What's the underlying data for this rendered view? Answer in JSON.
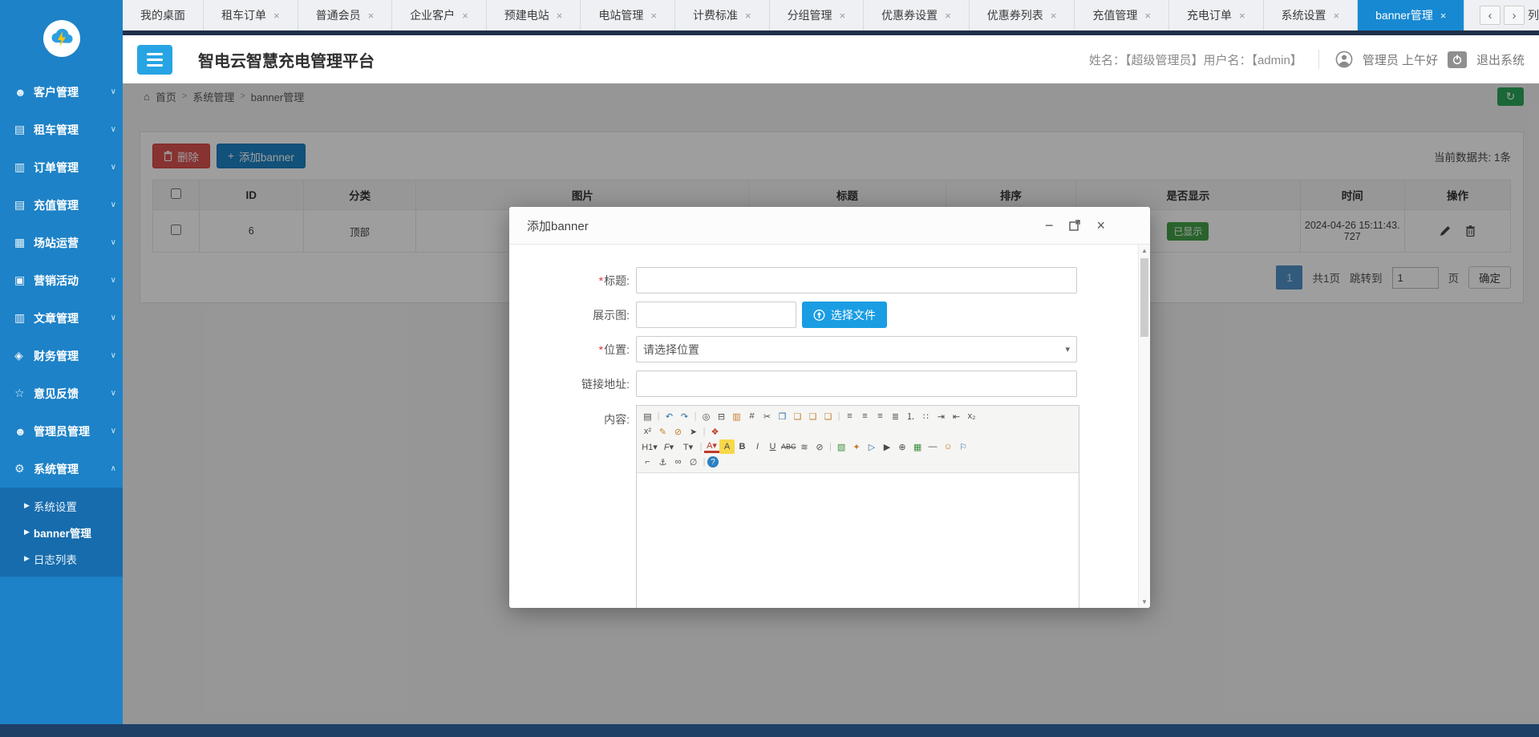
{
  "colors": {
    "sidebar_blue": "#1d82c7",
    "submenu_blue": "#176cad",
    "active_tab_blue": "#1789d2",
    "bright_blue": "#1a9de2",
    "add_blue": "#1c84c6",
    "danger_red": "#d9534f",
    "success_green": "#43a047",
    "refresh_green": "#2aa65a",
    "pager_blue": "#5192ca",
    "tab_border_dark": "#20304a",
    "footer_navy": "#1e4066"
  },
  "tabbar": {
    "close_glyph": "×",
    "prev": "‹",
    "next": "›",
    "overflow_label": "列",
    "tabs": [
      {
        "label": "我的桌面",
        "name": "tab-my-desktop",
        "noclose": true
      },
      {
        "label": "租车订单",
        "name": "tab-car-rental-orders"
      },
      {
        "label": "普通会员",
        "name": "tab-regular-members"
      },
      {
        "label": "企业客户",
        "name": "tab-enterprise-customers"
      },
      {
        "label": "预建电站",
        "name": "tab-prebuilt-stations"
      },
      {
        "label": "电站管理",
        "name": "tab-station-management"
      },
      {
        "label": "计费标准",
        "name": "tab-billing-standards"
      },
      {
        "label": "分组管理",
        "name": "tab-group-management"
      },
      {
        "label": "优惠券设置",
        "name": "tab-coupon-settings"
      },
      {
        "label": "优惠券列表",
        "name": "tab-coupon-list"
      },
      {
        "label": "充值管理",
        "name": "tab-recharge-management"
      },
      {
        "label": "充电订单",
        "name": "tab-charging-orders"
      },
      {
        "label": "系统设置",
        "name": "tab-system-settings"
      },
      {
        "label": "banner管理",
        "name": "tab-banner-management",
        "cls": "active"
      }
    ]
  },
  "sidebar": {
    "submenu_arrow": "▶",
    "menu": [
      {
        "icon": "☻",
        "iconname": "customer-icon",
        "label": "客户管理",
        "chev": "∨",
        "name": "sidebar-item-customer-mgmt"
      },
      {
        "icon": "▤",
        "iconname": "rental-card-icon",
        "label": "租车管理",
        "chev": "∨",
        "name": "sidebar-item-rental-mgmt"
      },
      {
        "icon": "▥",
        "iconname": "order-file-icon",
        "label": "订单管理",
        "chev": "∨",
        "name": "sidebar-item-order-mgmt"
      },
      {
        "icon": "▤",
        "iconname": "recharge-card-icon",
        "label": "充值管理",
        "chev": "∨",
        "name": "sidebar-item-recharge-mgmt"
      },
      {
        "icon": "▦",
        "iconname": "station-building-icon",
        "label": "场站运营",
        "chev": "∨",
        "name": "sidebar-item-station-ops"
      },
      {
        "icon": "▣",
        "iconname": "marketing-book-icon",
        "label": "营销活动",
        "chev": "∨",
        "name": "sidebar-item-marketing"
      },
      {
        "icon": "▥",
        "iconname": "article-doc-icon",
        "label": "文章管理",
        "chev": "∨",
        "name": "sidebar-item-article-mgmt"
      },
      {
        "icon": "◈",
        "iconname": "finance-lock-icon",
        "label": "财务管理",
        "chev": "∨",
        "name": "sidebar-item-finance-mgmt"
      },
      {
        "icon": "☆",
        "iconname": "feedback-star-icon",
        "label": "意见反馈",
        "chev": "∨",
        "name": "sidebar-item-feedback"
      },
      {
        "icon": "☻",
        "iconname": "admin-user-icon",
        "label": "管理员管理",
        "chev": "∨",
        "name": "sidebar-item-admin-mgmt"
      },
      {
        "icon": "⚙",
        "iconname": "system-gear-icon",
        "label": "系统管理",
        "chev": "∧",
        "name": "sidebar-item-system-mgmt"
      }
    ],
    "submenu": [
      {
        "label": "系统设置",
        "name": "submenu-system-settings"
      },
      {
        "label": "banner管理",
        "name": "submenu-banner-mgmt",
        "cls": "active"
      },
      {
        "label": "日志列表",
        "name": "submenu-log-list"
      }
    ]
  },
  "header": {
    "title": "智电云智慧充电管理平台",
    "user_info": "姓名：【超级管理员】用户名：【admin】",
    "greeting": "管理员 上午好",
    "logout": "退出系统"
  },
  "breadcrumb": {
    "home_icon": "⌂",
    "home": "首页",
    "sep": ">",
    "level1": "系统管理",
    "level2": "banner管理"
  },
  "panel": {
    "delete_btn": "删除",
    "add_icon": "+",
    "add_btn": "添加banner",
    "total": "当前数据共: 1条"
  },
  "table": {
    "headers": [
      "ID",
      "分类",
      "图片",
      "标题",
      "排序",
      "是否显示",
      "时间",
      "操作"
    ],
    "row": {
      "id": "6",
      "category": "顶部",
      "image": "",
      "title": "",
      "sort": "",
      "status": "已显示",
      "time": "2024-04-26 15:11:43.727"
    }
  },
  "pagination": {
    "page": "1",
    "total": "共1页",
    "jump_label": "跳转到",
    "jump_value": "1",
    "unit": "页",
    "confirm": "确定"
  },
  "modal": {
    "title": "添加banner",
    "min_glyph": "−",
    "close_glyph": "×",
    "scroll_up": "▲",
    "scroll_down": "▼",
    "fields": {
      "required_mark": "*",
      "title_label": "标题:",
      "image_label": "展示图:",
      "choose_file": "选择文件",
      "position_label": "位置:",
      "position_value": "请选择位置",
      "select_arrow": "▾",
      "link_label": "链接地址:",
      "content_label": "内容:"
    }
  },
  "editor": {
    "row1": [
      {
        "g": "▤",
        "n": "source-icon"
      },
      {
        "g": "|",
        "n": "separator-bar",
        "cls": "sep",
        "int": "false"
      },
      {
        "g": "↶",
        "n": "undo-icon",
        "cls": "blue"
      },
      {
        "g": "↷",
        "n": "redo-icon",
        "cls": "blue"
      },
      {
        "g": "|",
        "n": "separator-bar",
        "cls": "sep",
        "int": "false"
      },
      {
        "g": "◎",
        "n": "preview-icon"
      },
      {
        "g": "⊟",
        "n": "print-icon"
      },
      {
        "g": "▥",
        "n": "template-icon",
        "cls": "orange"
      },
      {
        "g": "#",
        "n": "code-icon"
      },
      {
        "g": "✂",
        "n": "cut-icon"
      },
      {
        "g": "❐",
        "n": "copy-icon",
        "cls": "blue"
      },
      {
        "g": "❏",
        "n": "paste-icon",
        "cls": "orange"
      },
      {
        "g": "❏",
        "n": "paste-text-icon",
        "cls": "orange"
      },
      {
        "g": "❏",
        "n": "paste-word-icon",
        "cls": "orange"
      },
      {
        "g": "|",
        "n": "separator-bar",
        "cls": "sep",
        "int": "false"
      },
      {
        "g": "≡",
        "n": "align-left-icon"
      },
      {
        "g": "≡",
        "n": "align-center-icon"
      },
      {
        "g": "≡",
        "n": "align-right-icon"
      },
      {
        "g": "≣",
        "n": "align-justify-icon"
      },
      {
        "g": "⒈",
        "n": "ordered-list-icon"
      },
      {
        "g": "∷",
        "n": "unordered-list-icon"
      },
      {
        "g": "⇥",
        "n": "indent-icon"
      },
      {
        "g": "⇤",
        "n": "outdent-icon"
      },
      {
        "g": "x₂",
        "n": "subscript-icon"
      }
    ],
    "row2": [
      {
        "g": "x²",
        "n": "superscript-icon"
      },
      {
        "g": "✎",
        "n": "format-painter-icon",
        "cls": "orange"
      },
      {
        "g": "⊘",
        "n": "clear-format-icon",
        "cls": "orange"
      },
      {
        "g": "➤",
        "n": "select-all-icon"
      },
      {
        "g": "|",
        "n": "separator-bar",
        "cls": "sep",
        "int": "false"
      },
      {
        "g": "❖",
        "n": "quick-format-icon",
        "cls": "red"
      }
    ],
    "row3": [
      {
        "g": "H1▾",
        "n": "heading-dropdown",
        "cls": "wide"
      },
      {
        "g": "F▾",
        "n": "font-family-dropdown",
        "cls": "wide italic"
      },
      {
        "g": "T▾",
        "n": "font-size-dropdown",
        "cls": "wide"
      },
      {
        "g": "|",
        "n": "separator-bar",
        "cls": "sep",
        "int": "false"
      },
      {
        "g": "A▾",
        "n": "text-color-icon",
        "cls": "fore"
      },
      {
        "g": "A",
        "n": "highlight-color-icon",
        "cls": "hilite"
      },
      {
        "g": "B",
        "n": "bold-icon",
        "cls": "bold"
      },
      {
        "g": "I",
        "n": "italic-icon",
        "cls": "italic"
      },
      {
        "g": "U",
        "n": "underline-icon",
        "cls": "underline"
      },
      {
        "g": "ABC",
        "n": "strikethrough-icon",
        "cls": "strike"
      },
      {
        "g": "≋",
        "n": "line-height-icon"
      },
      {
        "g": "⊘",
        "n": "remove-format-icon"
      },
      {
        "g": "|",
        "n": "separator-bar",
        "cls": "sep",
        "int": "false"
      },
      {
        "g": "▧",
        "n": "insert-image-icon",
        "cls": "green"
      },
      {
        "g": "✦",
        "n": "flash-icon",
        "cls": "orange"
      },
      {
        "g": "▷",
        "n": "media-icon",
        "cls": "blue"
      },
      {
        "g": "▶",
        "n": "movie-icon"
      },
      {
        "g": "⊕",
        "n": "attachment-icon"
      },
      {
        "g": "▦",
        "n": "insert-table-icon",
        "cls": "green"
      },
      {
        "g": "―",
        "n": "horizontal-rule-icon"
      },
      {
        "g": "☺",
        "n": "emoticons-icon",
        "cls": "orange"
      },
      {
        "g": "⚐",
        "n": "map-icon",
        "cls": "blue"
      }
    ],
    "row4": [
      {
        "g": "⌐",
        "n": "page-break-icon"
      },
      {
        "g": "⚓",
        "n": "anchor-icon"
      },
      {
        "g": "∞",
        "n": "link-icon"
      },
      {
        "g": "∅",
        "n": "unlink-icon"
      },
      {
        "g": "|",
        "n": "separator-bar",
        "cls": "sep",
        "int": "false"
      },
      {
        "g": "?",
        "n": "about-icon",
        "cls": "blue-badge"
      }
    ]
  }
}
